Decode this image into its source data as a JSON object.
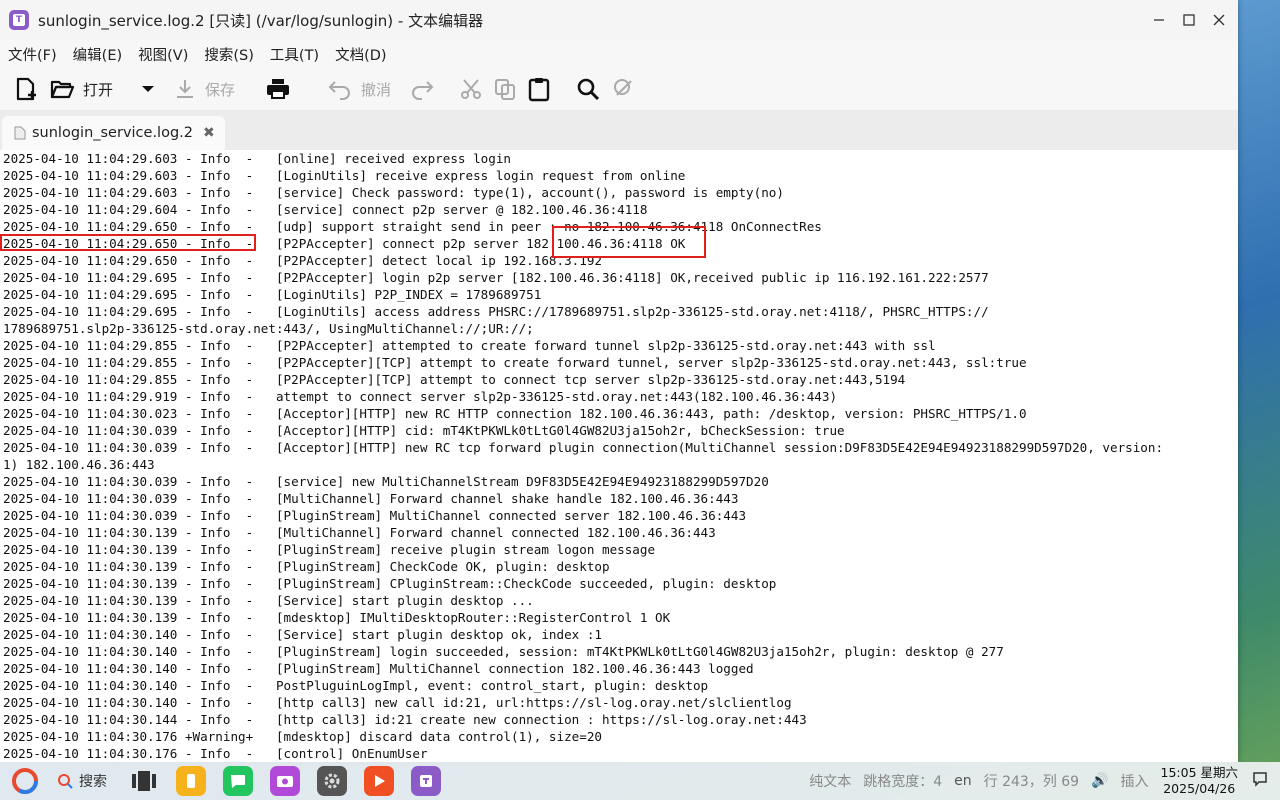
{
  "window": {
    "title": "sunlogin_service.log.2 [只读] (/var/log/sunlogin) - 文本编辑器",
    "app_icon_letter": "T"
  },
  "menu": [
    "文件(F)",
    "编辑(E)",
    "视图(V)",
    "搜索(S)",
    "工具(T)",
    "文档(D)"
  ],
  "toolbar": {
    "new_icon": "new-file-icon",
    "open_label": "打开",
    "save_label": "保存",
    "undo_label": "撤消"
  },
  "tab": {
    "label": "sunlogin_service.log.2"
  },
  "log_lines": [
    "2025-04-10 11:04:29.603 - Info  -   [online] received express login",
    "2025-04-10 11:04:29.603 - Info  -   [LoginUtils] receive express login request from online",
    "2025-04-10 11:04:29.603 - Info  -   [service] Check password: type(1), account(), password is empty(no)",
    "2025-04-10 11:04:29.604 - Info  -   [service] connect p2p server @ 182.100.46.36:4118",
    "2025-04-10 11:04:29.650 - Info  -   [udp] support straight send in peer : no 182.100.46.36:4118 OnConnectRes",
    "2025-04-10 11:04:29.650 - Info  -   [P2PAccepter] connect p2p server 182.100.46.36:4118 OK",
    "2025-04-10 11:04:29.650 - Info  -   [P2PAccepter] detect local ip 192.168.3.192",
    "2025-04-10 11:04:29.695 - Info  -   [P2PAccepter] login p2p server [182.100.46.36:4118] OK,received public ip 116.192.161.222:2577",
    "2025-04-10 11:04:29.695 - Info  -   [LoginUtils] P2P_INDEX = 1789689751",
    "2025-04-10 11:04:29.695 - Info  -   [LoginUtils] access address PHSRC://1789689751.slp2p-336125-std.oray.net:4118/, PHSRC_HTTPS://",
    "1789689751.slp2p-336125-std.oray.net:443/, UsingMultiChannel://;UR://;",
    "2025-04-10 11:04:29.855 - Info  -   [P2PAccepter] attempted to create forward tunnel slp2p-336125-std.oray.net:443 with ssl",
    "2025-04-10 11:04:29.855 - Info  -   [P2PAccepter][TCP] attempt to create forward tunnel, server slp2p-336125-std.oray.net:443, ssl:true",
    "2025-04-10 11:04:29.855 - Info  -   [P2PAccepter][TCP] attempt to connect tcp server slp2p-336125-std.oray.net:443,5194",
    "2025-04-10 11:04:29.919 - Info  -   attempt to connect server slp2p-336125-std.oray.net:443(182.100.46.36:443)",
    "2025-04-10 11:04:30.023 - Info  -   [Acceptor][HTTP] new RC HTTP connection 182.100.46.36:443, path: /desktop, version: PHSRC_HTTPS/1.0",
    "2025-04-10 11:04:30.039 - Info  -   [Acceptor][HTTP] cid: mT4KtPKWLk0tLtG0l4GW82U3ja15oh2r, bCheckSession: true",
    "2025-04-10 11:04:30.039 - Info  -   [Acceptor][HTTP] new RC tcp forward plugin connection(MultiChannel session:D9F83D5E42E94E94923188299D597D20, version:",
    "1) 182.100.46.36:443",
    "2025-04-10 11:04:30.039 - Info  -   [service] new MultiChannelStream D9F83D5E42E94E94923188299D597D20",
    "2025-04-10 11:04:30.039 - Info  -   [MultiChannel] Forward channel shake handle 182.100.46.36:443",
    "2025-04-10 11:04:30.039 - Info  -   [PluginStream] MultiChannel connected server 182.100.46.36:443",
    "2025-04-10 11:04:30.139 - Info  -   [MultiChannel] Forward channel connected 182.100.46.36:443",
    "2025-04-10 11:04:30.139 - Info  -   [PluginStream] receive plugin stream logon message",
    "2025-04-10 11:04:30.139 - Info  -   [PluginStream] CheckCode OK, plugin: desktop",
    "2025-04-10 11:04:30.139 - Info  -   [PluginStream] CPluginStream::CheckCode succeeded, plugin: desktop",
    "2025-04-10 11:04:30.139 - Info  -   [Service] start plugin desktop ...",
    "2025-04-10 11:04:30.139 - Info  -   [mdesktop] IMultiDesktopRouter::RegisterControl 1 OK",
    "2025-04-10 11:04:30.140 - Info  -   [Service] start plugin desktop ok, index :1",
    "2025-04-10 11:04:30.140 - Info  -   [PluginStream] login succeeded, session: mT4KtPKWLk0tLtG0l4GW82U3ja15oh2r, plugin: desktop @ 277",
    "2025-04-10 11:04:30.140 - Info  -   [PluginStream] MultiChannel connection 182.100.46.36:443 logged",
    "2025-04-10 11:04:30.140 - Info  -   PostPluguinLogImpl, event: control_start, plugin: desktop",
    "2025-04-10 11:04:30.140 - Info  -   [http call3] new call id:21, url:https://sl-log.oray.net/slclientlog",
    "2025-04-10 11:04:30.144 - Info  -   [http call3] id:21 create new connection : https://sl-log.oray.net:443",
    "2025-04-10 11:04:30.176 +Warning+   [mdesktop] discard data control(1), size=20",
    "2025-04-10 11:04:30.176 - Info  -   [control] OnEnumUser"
  ],
  "taskbar": {
    "search_label": "搜索",
    "status_text_format": "纯文本",
    "status_tab_width": "跳格宽度：4",
    "status_pos": "行 243，列 69",
    "status_insert": "插入",
    "lang": "en",
    "time": "15:05 星期六",
    "date": "2025/04/26"
  },
  "colors": {
    "highlight_box": "#e0201c",
    "app_purple": "#8b5cc8"
  }
}
